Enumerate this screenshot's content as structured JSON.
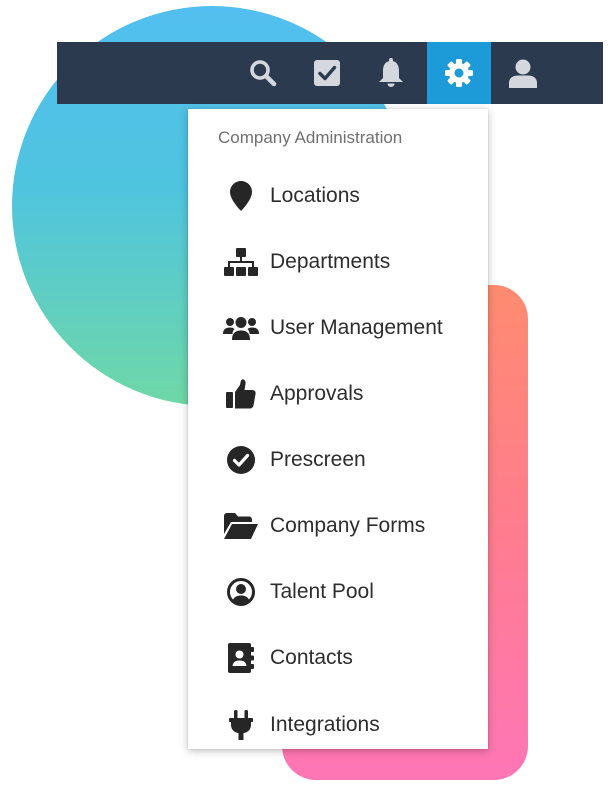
{
  "topbar": {
    "icons": [
      {
        "name": "search-icon",
        "active": false
      },
      {
        "name": "tasks-icon",
        "active": false
      },
      {
        "name": "bell-icon",
        "active": false
      },
      {
        "name": "gear-icon",
        "active": true
      },
      {
        "name": "user-icon",
        "active": false
      }
    ]
  },
  "menu": {
    "header": "Company Administration",
    "items": [
      {
        "label": "Locations",
        "icon": "map-marker-icon"
      },
      {
        "label": "Departments",
        "icon": "sitemap-icon"
      },
      {
        "label": "User Management",
        "icon": "users-icon"
      },
      {
        "label": "Approvals",
        "icon": "thumbs-up-icon"
      },
      {
        "label": "Prescreen",
        "icon": "check-circle-icon"
      },
      {
        "label": "Company Forms",
        "icon": "folder-open-icon"
      },
      {
        "label": "Talent Pool",
        "icon": "user-circle-icon"
      },
      {
        "label": "Contacts",
        "icon": "address-book-icon"
      },
      {
        "label": "Integrations",
        "icon": "plug-icon"
      }
    ]
  },
  "colors": {
    "topbar_bg": "#2b3a4e",
    "active_bg": "#1d9ad8",
    "circle_gradient": [
      "#52bff0",
      "#6fd8a6"
    ],
    "card_gradient": [
      "#ff8b70",
      "#ff76b6"
    ]
  }
}
